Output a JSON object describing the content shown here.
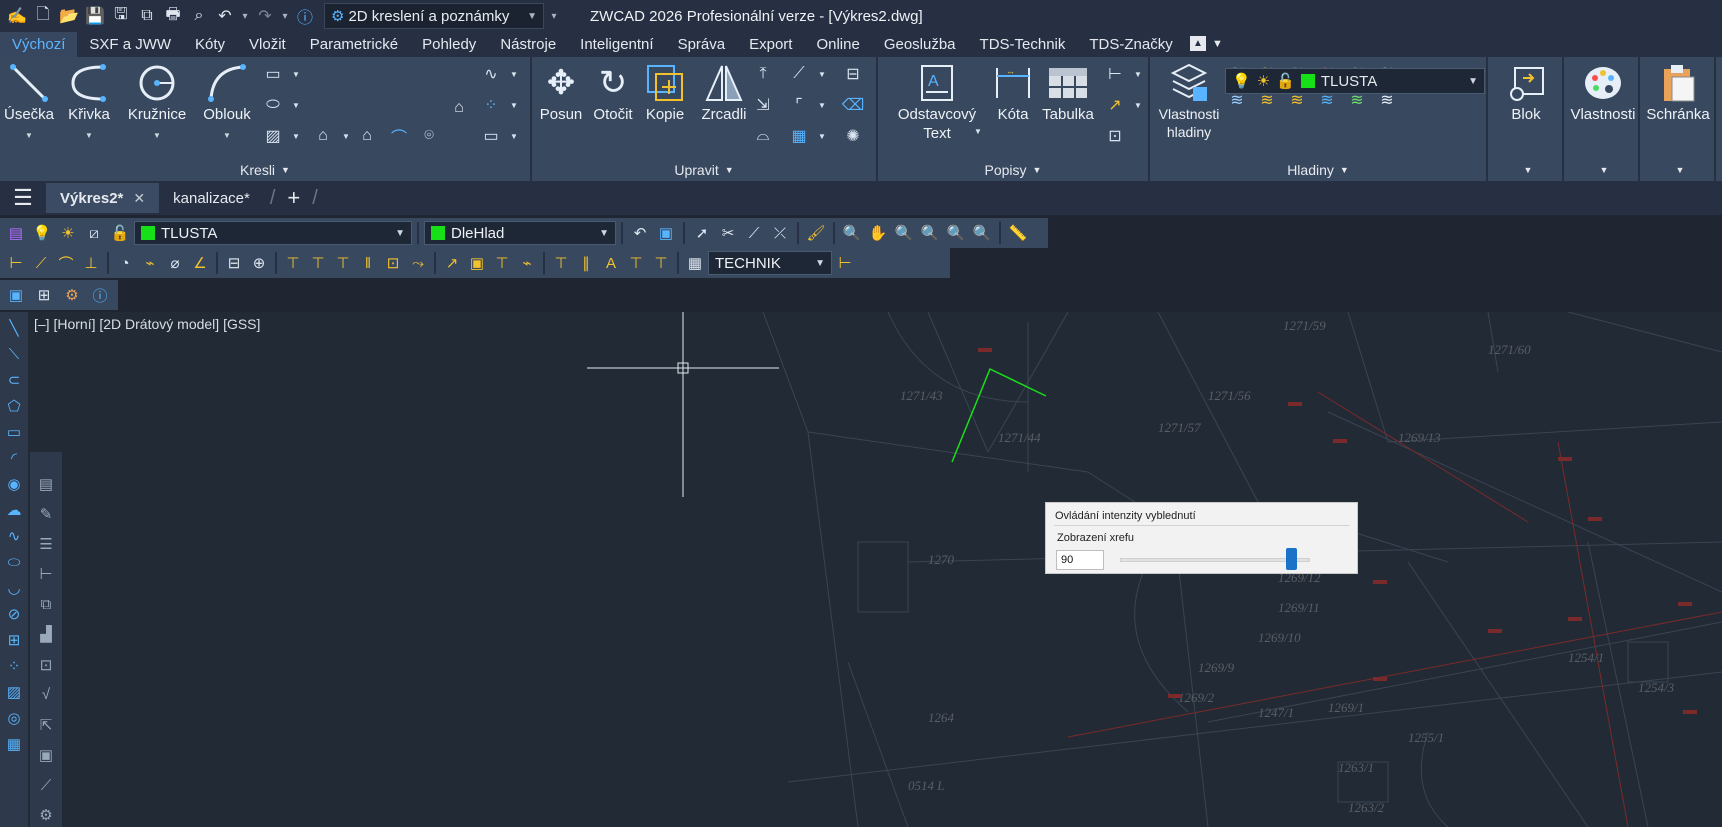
{
  "titlebar": {
    "app_icon": "zwcad-logo-icon",
    "quick_access": [
      "new-file-icon",
      "open-folder-icon",
      "save-icon",
      "save-as-icon",
      "copy-sheets-icon",
      "print-icon",
      "preview-icon",
      "undo-icon",
      "redo-icon",
      "help-icon"
    ],
    "workspace": "2D kreslení a poznámky",
    "title": "ZWCAD 2026 Profesionální verze - [Výkres2.dwg]"
  },
  "menu": {
    "tabs": [
      "Výchozí",
      "SXF a JWW",
      "Kóty",
      "Vložit",
      "Parametrické",
      "Pohledy",
      "Nástroje",
      "Inteligentní",
      "Správa",
      "Export",
      "Online",
      "Geoslužba",
      "TDS-Technik",
      "TDS-Značky"
    ],
    "active": "Výchozí"
  },
  "ribbon": {
    "kresli": {
      "title": "Kresli",
      "buttons": [
        "Úsečka",
        "Křivka",
        "Kružnice",
        "Oblouk"
      ]
    },
    "upravit": {
      "title": "Upravit",
      "buttons": [
        "Posun",
        "Otočit",
        "Kopie",
        "Zrcadli"
      ]
    },
    "popisy": {
      "title": "Popisy",
      "buttons": [
        "Odstavcový Text",
        "Kóta",
        "Tabulka"
      ]
    },
    "hladiny": {
      "title": "Hladiny",
      "button": "Vlastnosti hladiny",
      "layer": "TLUSTA"
    },
    "blok": {
      "label": "Blok"
    },
    "vlastnosti": {
      "label": "Vlastnosti"
    },
    "schranka": {
      "label": "Schránka"
    }
  },
  "doctabs": {
    "tabs": [
      {
        "label": "Výkres2*",
        "active": true
      },
      {
        "label": "kanalizace*",
        "active": false
      }
    ],
    "plus": "+"
  },
  "properties": {
    "layer": "TLUSTA",
    "color": "DleHlad",
    "accent_green": "#18e018"
  },
  "dimstyle": {
    "value": "TECHNIK"
  },
  "view": {
    "label": "[–] [Horní] [2D Drátový model] [GSS]"
  },
  "fade_dialog": {
    "title": "Ovládání intenzity vyblednutí",
    "subtitle": "Zobrazení xrefu",
    "value": "90",
    "slider_fraction": 0.9
  },
  "parcels": [
    "1271/59",
    "1271/60",
    "1271/43",
    "1271/56",
    "1271/44",
    "1271/57",
    "1269/13",
    "1270",
    "1269/12",
    "1269/11",
    "1269/10",
    "1269/9",
    "1269/2",
    "1269/1",
    "1264",
    "1247/1",
    "1255/1",
    "1254/1",
    "1254/3",
    "1263/1",
    "1263/2",
    "0514 L"
  ]
}
